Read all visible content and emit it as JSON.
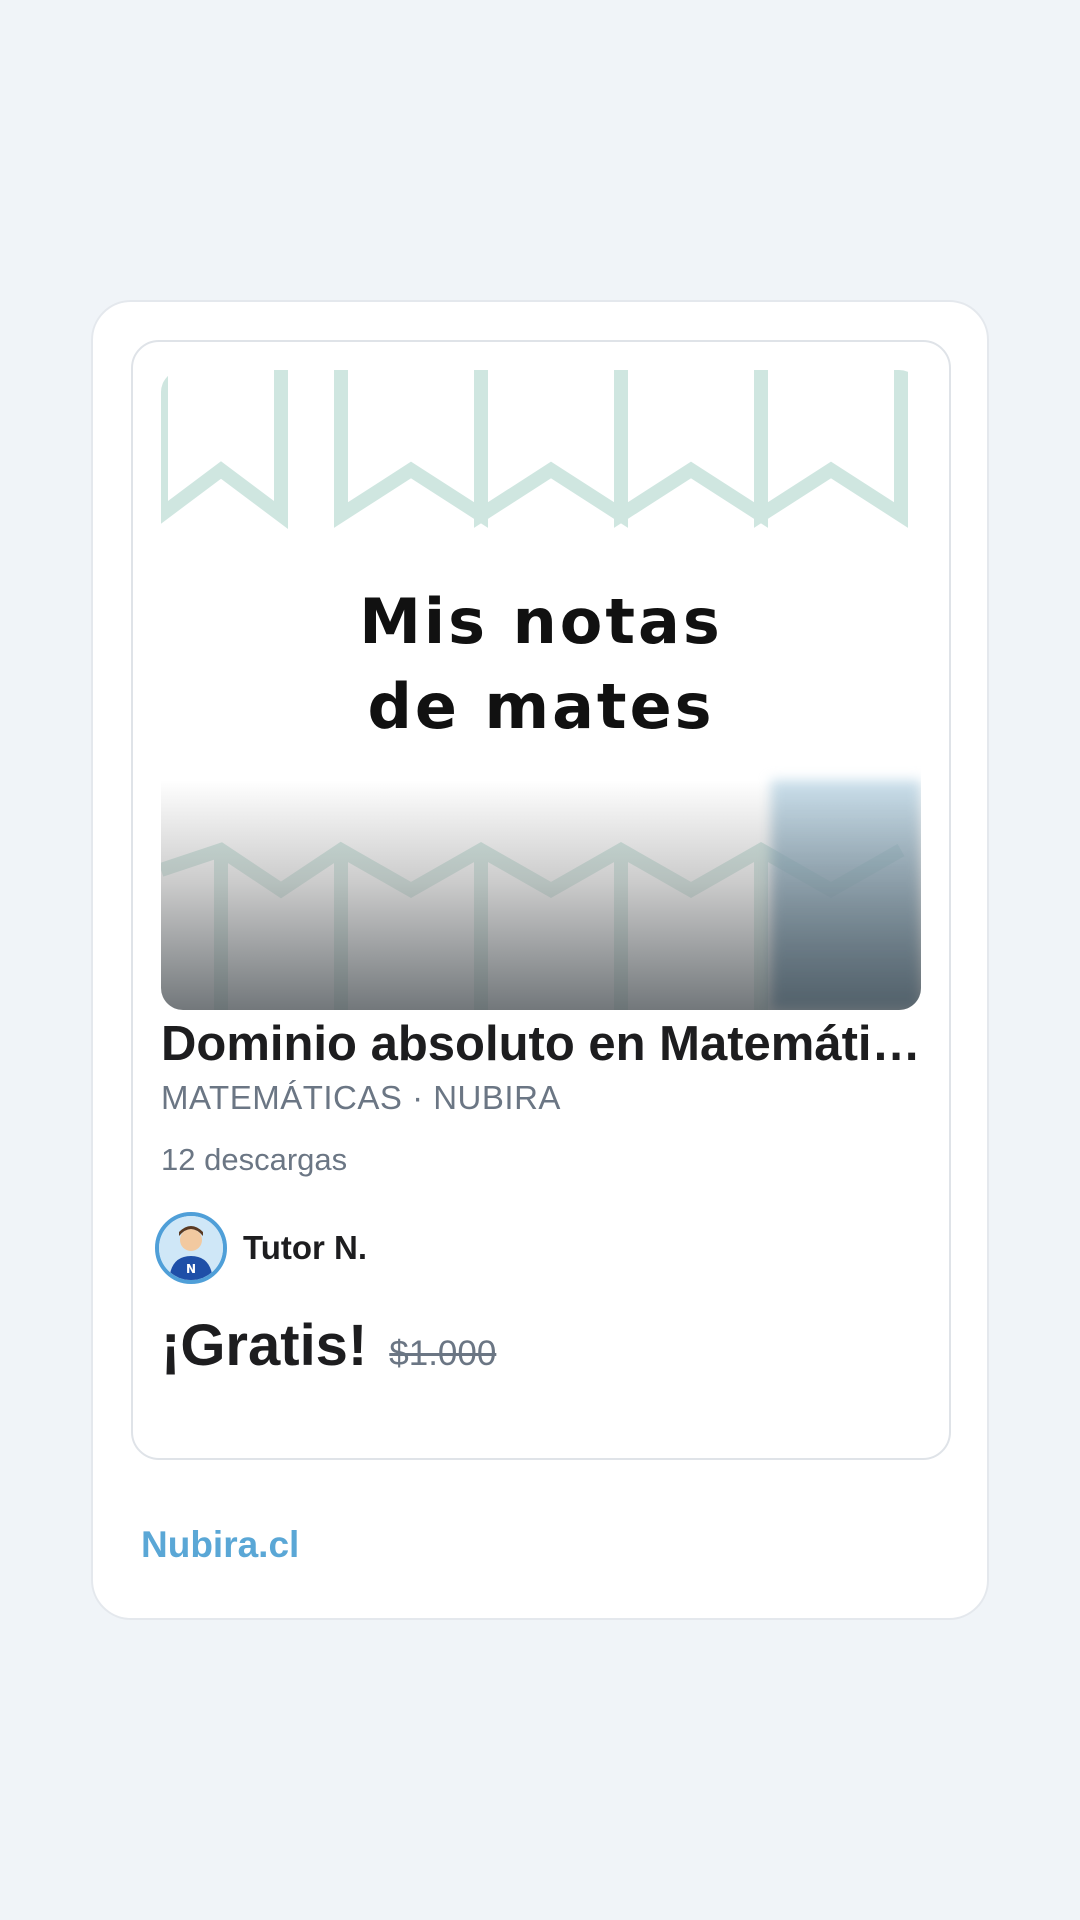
{
  "card": {
    "thumbnail": {
      "line1": "Mis notas",
      "line2": "de mates"
    },
    "title": "Dominio absoluto en Matemáticas",
    "subtitle": "MATEMÁTICAS · NUBIRA",
    "downloads": "12 descargas",
    "author": {
      "name": "Tutor N."
    },
    "price": {
      "current": "¡Gratis!",
      "original": "$1.000"
    }
  },
  "footer": {
    "brand": "Nubira.cl"
  },
  "colors": {
    "background": "#f0f4f8",
    "brand": "#5aa7d6",
    "muted_text": "#6b7684",
    "text": "#1d1d1f"
  }
}
